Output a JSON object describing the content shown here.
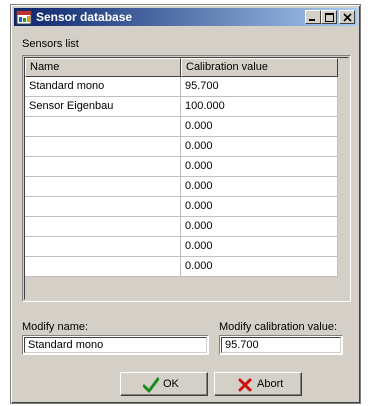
{
  "window": {
    "title": "Sensor database"
  },
  "list": {
    "label": "Sensors list",
    "columns": [
      "Name",
      "Calibration value"
    ],
    "rows": [
      {
        "name": "Standard mono",
        "value": "95.700"
      },
      {
        "name": "Sensor Eigenbau",
        "value": "100.000"
      },
      {
        "name": "",
        "value": "0.000"
      },
      {
        "name": "",
        "value": "0.000"
      },
      {
        "name": "",
        "value": "0.000"
      },
      {
        "name": "",
        "value": "0.000"
      },
      {
        "name": "",
        "value": "0.000"
      },
      {
        "name": "",
        "value": "0.000"
      },
      {
        "name": "",
        "value": "0.000"
      },
      {
        "name": "",
        "value": "0.000"
      }
    ]
  },
  "modify": {
    "name_label": "Modify name:",
    "name_value": "Standard mono",
    "value_label": "Modify calibration value:",
    "value_value": "95.700"
  },
  "buttons": {
    "ok": "OK",
    "abort": "Abort"
  },
  "icons": {
    "app": "database-icon",
    "minimize": "minimize-icon",
    "maximize": "maximize-icon",
    "close": "close-icon",
    "ok": "checkmark-icon",
    "abort": "x-icon"
  },
  "colors": {
    "ok_icon": "#1a8a1a",
    "abort_icon": "#cc1111"
  }
}
